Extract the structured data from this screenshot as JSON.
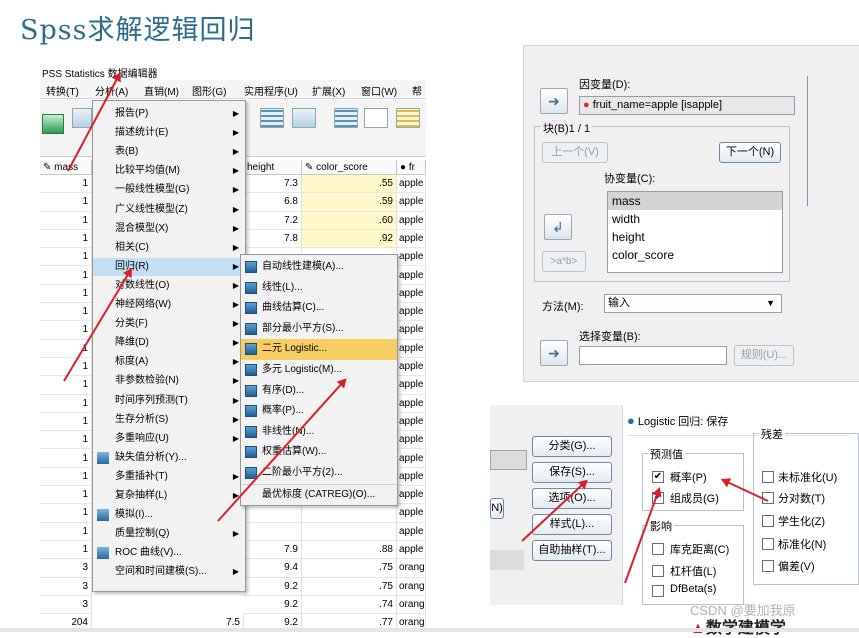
{
  "slide": {
    "title": "Spss求解逻辑回归"
  },
  "spss": {
    "app_title": "PSS Statistics 数据编辑器",
    "menubar": [
      "转换(T)",
      "分析(A)",
      "直销(M)",
      "图形(G)",
      "实用程序(U)",
      "扩展(X)",
      "窗口(W)",
      "帮"
    ],
    "columns": [
      "mass",
      "height",
      "color_score",
      "fr"
    ],
    "rows": [
      {
        "row": "1",
        "height": "7.3",
        "color_score": ".55",
        "fruit": "apple"
      },
      {
        "row": "1",
        "height": "6.8",
        "color_score": ".59",
        "fruit": "apple"
      },
      {
        "row": "1",
        "height": "7.2",
        "color_score": ".60",
        "fruit": "apple"
      },
      {
        "row": "1",
        "height": "7.8",
        "color_score": ".92",
        "fruit": "apple"
      },
      {
        "row": "1",
        "height": "",
        "color_score": "",
        "fruit": "apple"
      },
      {
        "row": "1",
        "height": "",
        "color_score": "",
        "fruit": "apple"
      },
      {
        "row": "1",
        "height": "",
        "color_score": "",
        "fruit": "apple"
      },
      {
        "row": "1",
        "height": "",
        "color_score": "",
        "fruit": "apple"
      },
      {
        "row": "1",
        "height": "",
        "color_score": "",
        "fruit": "apple"
      },
      {
        "row": "1",
        "height": "",
        "color_score": "",
        "fruit": "apple"
      },
      {
        "row": "1",
        "height": "",
        "color_score": "",
        "fruit": "apple"
      },
      {
        "row": "1",
        "height": "",
        "color_score": "",
        "fruit": "apple"
      },
      {
        "row": "1",
        "height": "",
        "color_score": "",
        "fruit": "apple"
      },
      {
        "row": "1",
        "height": "",
        "color_score": "",
        "fruit": "apple"
      },
      {
        "row": "1",
        "height": "",
        "color_score": "",
        "fruit": "apple"
      },
      {
        "row": "1",
        "height": "",
        "color_score": "",
        "fruit": "apple"
      },
      {
        "row": "1",
        "height": "",
        "color_score": "",
        "fruit": "apple"
      },
      {
        "row": "1",
        "height": "",
        "color_score": "",
        "fruit": "apple"
      },
      {
        "row": "1",
        "height": "",
        "color_score": "",
        "fruit": "apple"
      },
      {
        "row": "1",
        "height": "",
        "color_score": "",
        "fruit": "apple"
      },
      {
        "row": "1",
        "height": "7.9",
        "color_score": ".88",
        "fruit": "apple"
      },
      {
        "row": "3",
        "height": "9.4",
        "color_score": ".75",
        "fruit": "orang"
      },
      {
        "row": "3",
        "height": "9.2",
        "color_score": ".75",
        "fruit": "orang"
      },
      {
        "row": "3",
        "height": "9.2",
        "color_score": ".74",
        "fruit": "orang"
      },
      {
        "row": "204",
        "row2": "7.5",
        "height": "9.2",
        "color_score": ".77",
        "fruit": "orang"
      }
    ],
    "analyze_menu": [
      {
        "label": "报告(P)",
        "sub": true
      },
      {
        "label": "描述统计(E)",
        "sub": true
      },
      {
        "label": "表(B)",
        "sub": true
      },
      {
        "label": "比较平均值(M)",
        "sub": true
      },
      {
        "label": "一般线性模型(G)",
        "sub": true
      },
      {
        "label": "广义线性模型(Z)",
        "sub": true
      },
      {
        "label": "混合模型(X)",
        "sub": true
      },
      {
        "label": "相关(C)",
        "sub": true
      },
      {
        "label": "回归(R)",
        "sub": true,
        "active": true
      },
      {
        "label": "对数线性(O)",
        "sub": true
      },
      {
        "label": "神经网络(W)",
        "sub": true
      },
      {
        "label": "分类(F)",
        "sub": true
      },
      {
        "label": "降维(D)",
        "sub": true
      },
      {
        "label": "标度(A)",
        "sub": true
      },
      {
        "label": "非参数检验(N)",
        "sub": true
      },
      {
        "label": "时间序列预测(T)",
        "sub": true
      },
      {
        "label": "生存分析(S)",
        "sub": true
      },
      {
        "label": "多重响应(U)",
        "sub": true
      },
      {
        "label": "缺失值分析(Y)...",
        "sub": false,
        "icon": true
      },
      {
        "label": "多重插补(T)",
        "sub": true
      },
      {
        "label": "复杂抽样(L)",
        "sub": true
      },
      {
        "label": "模拟(I)...",
        "sub": false,
        "icon": true
      },
      {
        "label": "质量控制(Q)",
        "sub": true
      },
      {
        "label": "ROC 曲线(V)...",
        "sub": false,
        "icon": true
      },
      {
        "label": "空间和时间建模(S)...",
        "sub": true
      }
    ],
    "regression_menu": [
      {
        "label": "自动线性建模(A)..."
      },
      {
        "label": "线性(L)..."
      },
      {
        "label": "曲线估算(C)..."
      },
      {
        "label": "部分最小平方(S)..."
      },
      {
        "label": "二元 Logistic...",
        "active": true
      },
      {
        "label": "多元 Logistic(M)..."
      },
      {
        "label": "有序(D)..."
      },
      {
        "label": "概率(P)..."
      },
      {
        "label": "非线性(N)..."
      },
      {
        "label": "权重估算(W)..."
      },
      {
        "label": "二阶最小平方(2)..."
      },
      {
        "label": "最优标度 (CATREG)(O)...",
        "plain": true
      }
    ]
  },
  "logistic_dialog": {
    "dependent_label": "因变量(D):",
    "dependent_value": "fruit_name=apple [isapple]",
    "block_label": "块(B)1 / 1",
    "prev_button": "上一个(V)",
    "next_button": "下一个(N)",
    "covariates_label": "协变量(C):",
    "covariates": [
      "mass",
      "width",
      "height",
      "color_score"
    ],
    "interaction_button": ">a*b>",
    "method_label": "方法(M):",
    "method_value": "输入",
    "selection_label": "选择变量(B):",
    "rule_button": "规则(U)..."
  },
  "save_dialog": {
    "title": "Logistic 回归: 保存",
    "left_buttons": [
      "分类(G)...",
      "保存(S)...",
      "选项(O)...",
      "样式(L)...",
      "自助抽样(T)..."
    ],
    "partial_button": "N)",
    "predicted_group": "预测值",
    "predicted_items": [
      {
        "label": "概率(P)",
        "checked": true
      },
      {
        "label": "组成员(G)",
        "checked": true
      }
    ],
    "residuals_group": "残差",
    "residual_items": [
      {
        "label": "未标准化(U)",
        "checked": false
      },
      {
        "label": "分对数(T)",
        "checked": false
      },
      {
        "label": "学生化(Z)",
        "checked": false
      },
      {
        "label": "标准化(N)",
        "checked": false
      },
      {
        "label": "偏差(V)",
        "checked": false
      }
    ],
    "influence_group": "影响",
    "influence_items": [
      {
        "label": "库克距离(C)",
        "checked": false
      },
      {
        "label": "杠杆值(L)",
        "checked": false
      },
      {
        "label": "DfBeta(s)",
        "checked": false
      }
    ]
  },
  "watermark": {
    "csdn": "CSDN @要加我原",
    "logo": "数学建模学"
  }
}
